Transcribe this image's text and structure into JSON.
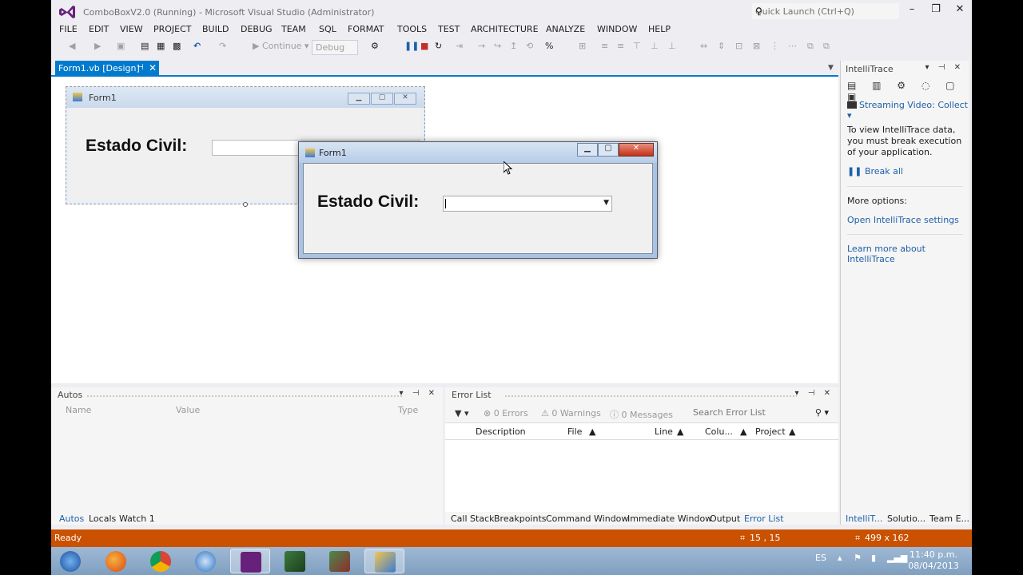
{
  "window": {
    "title": "ComboBoxV2.0 (Running) - Microsoft Visual Studio (Administrator)",
    "quick_launch_placeholder": "Quick Launch (Ctrl+Q)"
  },
  "menu": [
    "FILE",
    "EDIT",
    "VIEW",
    "PROJECT",
    "BUILD",
    "DEBUG",
    "TEAM",
    "SQL",
    "FORMAT",
    "TOOLS",
    "TEST",
    "ARCHITECTURE",
    "ANALYZE",
    "WINDOW",
    "HELP"
  ],
  "toolbar": {
    "continue_label": "Continue",
    "config_value": "Debug"
  },
  "document_tab": {
    "label": "Form1.vb [Design]"
  },
  "designer_form": {
    "title": "Form1",
    "label": "Estado Civil:"
  },
  "running_form": {
    "title": "Form1",
    "label": "Estado Civil:",
    "combo_value": ""
  },
  "intellitrace": {
    "title": "IntelliTrace",
    "stream_label": "Streaming Video: Collect",
    "info_text": "To view IntelliTrace data, you must break execution of your application.",
    "break_all": "Break all",
    "more_options": "More options:",
    "open_settings": "Open IntelliTrace settings",
    "learn_more": "Learn more about IntelliTrace"
  },
  "autos": {
    "title": "Autos",
    "columns": [
      "Name",
      "Value",
      "Type"
    ]
  },
  "error_list": {
    "title": "Error List",
    "errors": "0 Errors",
    "warnings": "0 Warnings",
    "messages": "0 Messages",
    "search_placeholder": "Search Error List",
    "columns": [
      "Description",
      "File",
      "Line",
      "Colu...",
      "Project"
    ]
  },
  "bottom_tabs_left": [
    "Autos",
    "Locals",
    "Watch 1"
  ],
  "bottom_tabs_right": [
    "Call Stack",
    "Breakpoints",
    "Command Window",
    "Immediate Window",
    "Output",
    "Error List"
  ],
  "bottom_tabs_far": [
    "IntelliT...",
    "Solutio...",
    "Team E..."
  ],
  "status": {
    "text": "Ready",
    "position": "15 , 15",
    "size": "499 x 162"
  },
  "taskbar": {
    "lang": "ES",
    "time": "11:40 p.m.",
    "date": "08/04/2013"
  },
  "colors": {
    "accent": "#007acc",
    "status_bar": "#ca5100"
  }
}
